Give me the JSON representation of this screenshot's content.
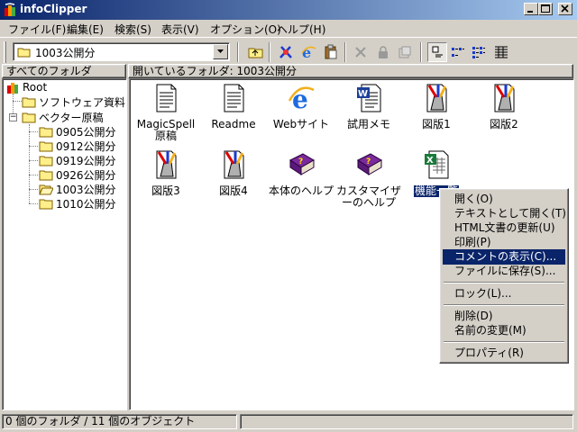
{
  "window": {
    "title": "infoClipper"
  },
  "menubar": {
    "items": [
      "ファイル(F)",
      "編集(E)",
      "検索(S)",
      "表示(V)",
      "オプション(O)",
      "ヘルプ(H)"
    ]
  },
  "toolbar": {
    "folder_value": "1003公開分"
  },
  "left_pane": {
    "header": "すべてのフォルダ",
    "tree": [
      {
        "label": "Root"
      },
      {
        "label": "ソフトウェア資料"
      },
      {
        "label": "ベクター原稿"
      },
      {
        "label": "0905公開分"
      },
      {
        "label": "0912公開分"
      },
      {
        "label": "0919公開分"
      },
      {
        "label": "0926公開分"
      },
      {
        "label": "1003公開分"
      },
      {
        "label": "1010公開分"
      }
    ]
  },
  "right_pane": {
    "header": "開いているフォルダ: 1003公開分",
    "files": [
      {
        "name": "MagicSpell原稿",
        "icon": "text-document-icon"
      },
      {
        "name": "Readme",
        "icon": "text-document-icon"
      },
      {
        "name": "Webサイト",
        "icon": "internet-explorer-icon"
      },
      {
        "name": "試用メモ",
        "icon": "word-document-icon"
      },
      {
        "name": "図版1",
        "icon": "paint-document-icon"
      },
      {
        "name": "図版2",
        "icon": "paint-document-icon"
      },
      {
        "name": "図版3",
        "icon": "paint-document-icon"
      },
      {
        "name": "図版4",
        "icon": "paint-document-icon"
      },
      {
        "name": "本体のヘルプ",
        "icon": "help-book-icon"
      },
      {
        "name": "カスタマイザーのヘルプ",
        "icon": "help-book-icon"
      },
      {
        "name": "機能一覧",
        "icon": "excel-document-icon",
        "selected": true
      }
    ]
  },
  "context_menu": {
    "items": [
      {
        "label": "開く(O)"
      },
      {
        "label": "テキストとして開く(T)"
      },
      {
        "label": "HTML文書の更新(U)"
      },
      {
        "label": "印刷(P)"
      },
      {
        "label": "コメントの表示(C)...",
        "highlighted": true
      },
      {
        "label": "ファイルに保存(S)..."
      },
      {
        "label": "ロック(L)..."
      },
      {
        "label": "削除(D)"
      },
      {
        "label": "名前の変更(M)"
      },
      {
        "label": "プロパティ(R)"
      }
    ]
  },
  "statusbar": {
    "text": "0 個のフォルダ / 11 個のオブジェクト"
  },
  "colors": {
    "titlebar": "#0a246a",
    "face": "#d4d0c8",
    "selection": "#0a246a"
  }
}
